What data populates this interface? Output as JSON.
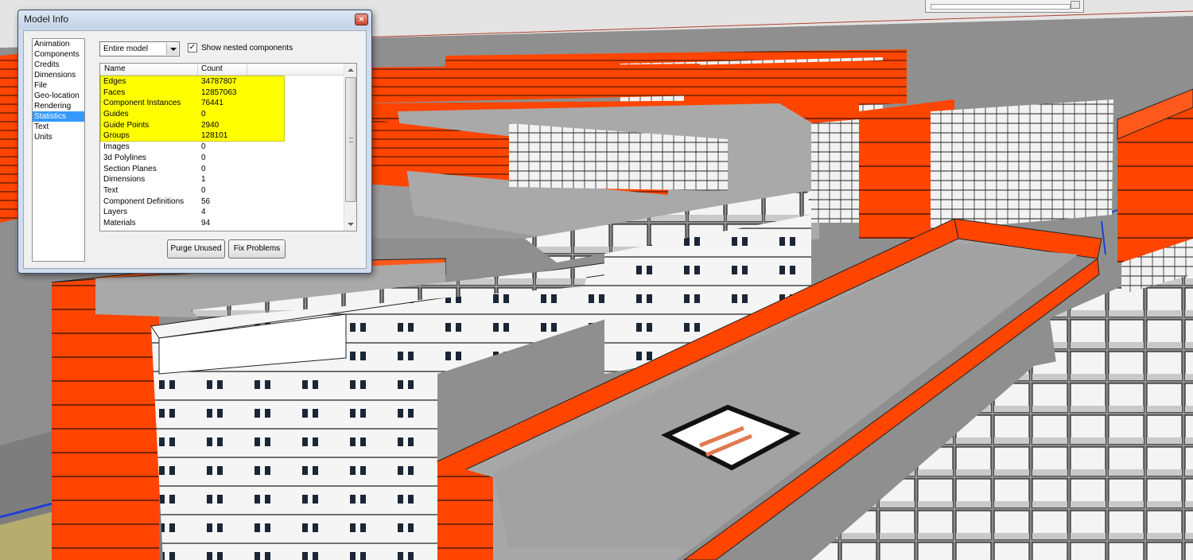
{
  "dialog": {
    "title": "Model Info",
    "close_glyph": "×",
    "categories": [
      {
        "label": "Animation",
        "selected": false
      },
      {
        "label": "Components",
        "selected": false
      },
      {
        "label": "Credits",
        "selected": false
      },
      {
        "label": "Dimensions",
        "selected": false
      },
      {
        "label": "File",
        "selected": false
      },
      {
        "label": "Geo-location",
        "selected": false
      },
      {
        "label": "Rendering",
        "selected": false
      },
      {
        "label": "Statistics",
        "selected": true
      },
      {
        "label": "Text",
        "selected": false
      },
      {
        "label": "Units",
        "selected": false
      }
    ],
    "scope": {
      "value": "Entire model"
    },
    "nested": {
      "label": "Show nested components",
      "checked": true,
      "check_glyph": "✓"
    },
    "table": {
      "headers": {
        "name": "Name",
        "count": "Count"
      },
      "rows": [
        {
          "name": "Edges",
          "count": "34787807"
        },
        {
          "name": "Faces",
          "count": "12857063"
        },
        {
          "name": "Component Instances",
          "count": "76441"
        },
        {
          "name": "Guides",
          "count": "0"
        },
        {
          "name": "Guide Points",
          "count": "2940"
        },
        {
          "name": "Groups",
          "count": "128101"
        },
        {
          "name": "Images",
          "count": "0"
        },
        {
          "name": "3d Polylines",
          "count": "0"
        },
        {
          "name": "Section Planes",
          "count": "0"
        },
        {
          "name": "Dimensions",
          "count": "1"
        },
        {
          "name": "Text",
          "count": "0"
        },
        {
          "name": "Component Definitions",
          "count": "56"
        },
        {
          "name": "Layers",
          "count": "4"
        },
        {
          "name": "Materials",
          "count": "94"
        }
      ],
      "highlight_color": "#ffff00"
    },
    "buttons": {
      "purge": "Purge Unused",
      "fix": "Fix Problems"
    }
  },
  "scene": {
    "colors": {
      "facade_orange": "#ff4500",
      "wall_white": "#f7f7f7",
      "roof_gray": "#a9a9a9",
      "ground_gray": "#8f8f8f",
      "sky": "#e4e4e4",
      "axis_blue": "#1f3fd6",
      "selection_blue": "#3399ff"
    }
  }
}
